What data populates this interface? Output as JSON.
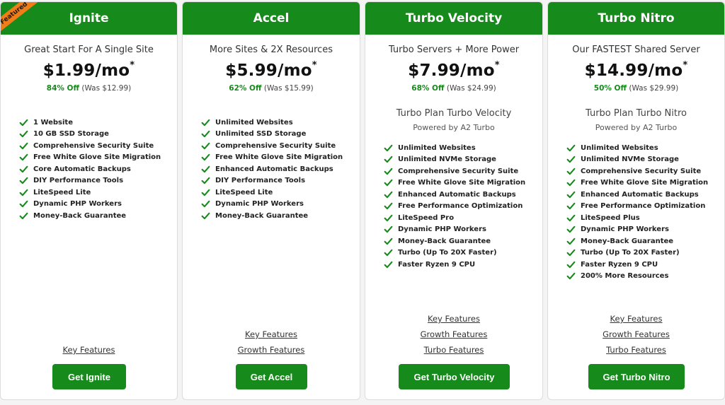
{
  "colors": {
    "brand_green": "#168a1b",
    "ribbon_orange": "#f07d18",
    "check_green": "#168a1b"
  },
  "plans": [
    {
      "name": "Ignite",
      "ribbon": "Featured",
      "tagline": "Great Start For A Single Site",
      "price": "$1.99/mo",
      "asterisk": "*",
      "discount_pct": "84% Off",
      "was": "(Was $12.99)",
      "features": [
        "1 Website",
        "10 GB SSD Storage",
        "Comprehensive Security Suite",
        "Free White Glove Site Migration",
        "Core Automatic Backups",
        "DIY Performance Tools",
        "LiteSpeed Lite",
        "Dynamic PHP Workers",
        "Money-Back Guarantee"
      ],
      "links": [
        "Key Features"
      ],
      "cta": "Get Ignite"
    },
    {
      "name": "Accel",
      "tagline": "More Sites & 2X Resources",
      "price": "$5.99/mo",
      "asterisk": "*",
      "discount_pct": "62% Off",
      "was": "(Was $15.99)",
      "features": [
        "Unlimited Websites",
        "Unlimited SSD Storage",
        "Comprehensive Security Suite",
        "Free White Glove Site Migration",
        "Enhanced Automatic Backups",
        "DIY Performance Tools",
        "LiteSpeed Lite",
        "Dynamic PHP Workers",
        "Money-Back Guarantee"
      ],
      "links": [
        "Key Features",
        "Growth Features"
      ],
      "cta": "Get Accel"
    },
    {
      "name": "Turbo Velocity",
      "tagline": "Turbo Servers + More Power",
      "price": "$7.99/mo",
      "asterisk": "*",
      "discount_pct": "68% Off",
      "was": "(Was $24.99)",
      "image_alt": "Turbo Plan Turbo Velocity",
      "powered": "Powered by A2 Turbo",
      "features": [
        "Unlimited Websites",
        "Unlimited NVMe Storage",
        "Comprehensive Security Suite",
        "Free White Glove Site Migration",
        "Enhanced Automatic Backups",
        "Free Performance Optimization",
        "LiteSpeed Pro",
        "Dynamic PHP Workers",
        "Money-Back Guarantee",
        "Turbo (Up To 20X Faster)",
        "Faster Ryzen 9 CPU"
      ],
      "links": [
        "Key Features",
        "Growth Features",
        "Turbo Features"
      ],
      "cta": "Get Turbo Velocity"
    },
    {
      "name": "Turbo Nitro",
      "tagline": "Our FASTEST Shared Server",
      "price": "$14.99/mo",
      "asterisk": "*",
      "discount_pct": "50% Off",
      "was": "(Was $29.99)",
      "image_alt": "Turbo Plan Turbo Nitro",
      "powered": "Powered by A2 Turbo",
      "features": [
        "Unlimited Websites",
        "Unlimited NVMe Storage",
        "Comprehensive Security Suite",
        "Free White Glove Site Migration",
        "Enhanced Automatic Backups",
        "Free Performance Optimization",
        "LiteSpeed Plus",
        "Dynamic PHP Workers",
        "Money-Back Guarantee",
        "Turbo (Up To 20X Faster)",
        "Faster Ryzen 9 CPU",
        "200% More Resources"
      ],
      "links": [
        "Key Features",
        "Growth Features",
        "Turbo Features"
      ],
      "cta": "Get Turbo Nitro"
    }
  ]
}
